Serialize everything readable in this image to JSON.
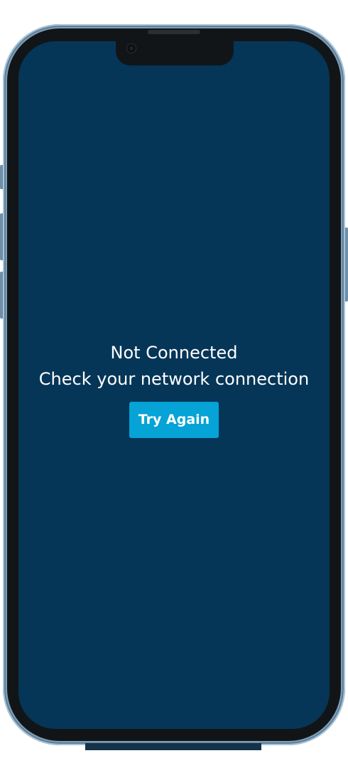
{
  "screen": {
    "title": "Not Connected",
    "subtitle": "Check your network connection",
    "retry_button_label": "Try Again"
  },
  "colors": {
    "screen_background": "#053658",
    "button_background": "#05a3d6",
    "text": "#ffffff",
    "frame": "#7f9fb8",
    "bezel": "#121517"
  }
}
